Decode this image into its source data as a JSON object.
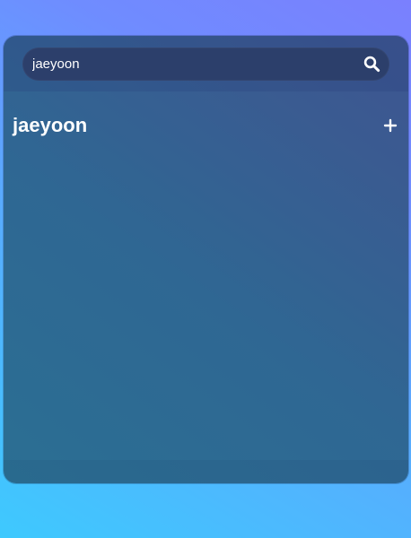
{
  "search": {
    "value": "jaeyoon",
    "icon": "search-icon"
  },
  "list": {
    "title": "jaeyoon",
    "add_icon": "plus-icon"
  },
  "colors": {
    "background_start": "#3ec9fe",
    "background_end": "#7a80fe",
    "card": "#2f6793",
    "search_bar": "#2c3f6b",
    "text": "#ffffff"
  }
}
